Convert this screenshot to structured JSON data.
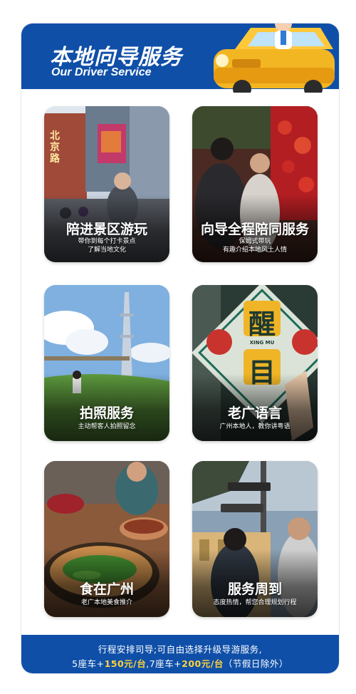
{
  "header": {
    "title_cn": "本地向导服务",
    "title_en": "Our Driver Service"
  },
  "tiles": [
    {
      "title": "陪进景区游玩",
      "sub1": "带你到每个打卡景点",
      "sub2": "了解当地文化",
      "scene": "street-mall-photo"
    },
    {
      "title": "向导全程陪同服务",
      "sub1": "保姆式带玩",
      "sub2": "有趣介绍本地风土人情",
      "scene": "red-lantern-market-photo"
    },
    {
      "title": "拍照服务",
      "sub1": "主动帮客人拍照留念",
      "sub2": "",
      "scene": "canton-tower-lawn-photo"
    },
    {
      "title": "老广语言",
      "sub1": "广州本地人，教你讲粤语",
      "sub2": "",
      "scene": "cantonese-poster-photo"
    },
    {
      "title": "食在广州",
      "sub1": "老广本地美食推介",
      "sub2": "",
      "scene": "local-food-photo"
    },
    {
      "title": "服务周到",
      "sub1": "态度热情，帮您合理规划行程",
      "sub2": "",
      "scene": "street-signpost-photo"
    }
  ],
  "poster_sign": {
    "char_top": "醒",
    "char_bottom": "目",
    "pinyin": "XING MU"
  },
  "street_sign_text": "北京路",
  "footer": {
    "line1": "行程安排司导;可自由选择升级导游服务,",
    "line2_a": "5座车+",
    "price_5": "150元/台",
    "line2_b": ",7座车+",
    "price_7": "200元/台",
    "line2_c": "（节假日除外）"
  },
  "colors": {
    "brand_blue": "#0f4fa8",
    "price_yellow": "#ffd23c"
  }
}
